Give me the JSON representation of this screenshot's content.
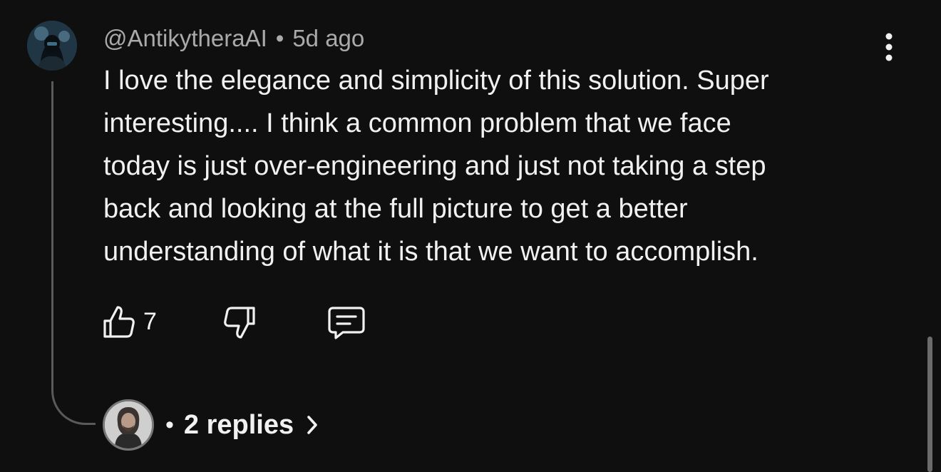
{
  "comment": {
    "author": "@AntikytheraAI",
    "separator": "•",
    "time": "5d ago",
    "text": "I love the elegance and simplicity of this solution. Super\ninteresting.... I think a common problem that we face\ntoday is just over-engineering and just not taking a step\nback and looking at the full picture to get a better\nunderstanding of what it is that we want to accomplish.",
    "like_count": "7"
  },
  "replies": {
    "separator": "•",
    "label": "2 replies"
  },
  "icons": {
    "menu": "more-vertical-icon",
    "like": "thumbs-up-icon",
    "dislike": "thumbs-down-icon",
    "reply": "comment-icon",
    "expand": "chevron-right-icon"
  },
  "colors": {
    "background": "#0f0f0f",
    "text": "#f1f1f1",
    "meta": "#aaaaaa",
    "thread_line": "#5a5a5a"
  }
}
